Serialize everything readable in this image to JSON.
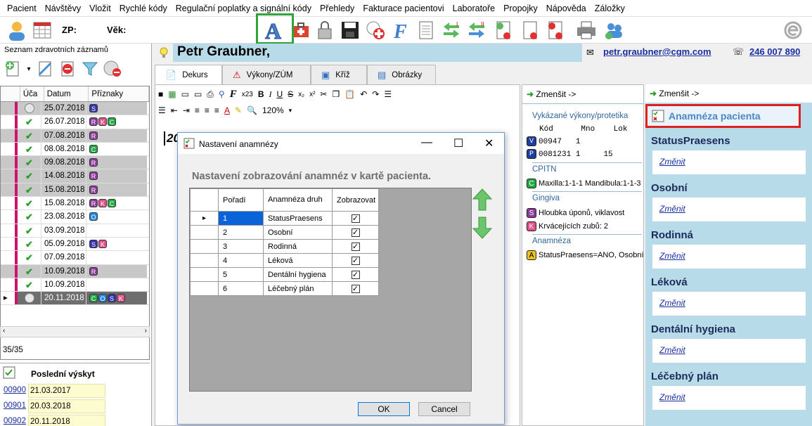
{
  "menu": [
    "Pacient",
    "Návštěvy",
    "Vložit",
    "Rychlé kódy",
    "Regulační poplatky a signální kódy",
    "Přehledy",
    "Fakturace pacientovi",
    "Laboratoře",
    "Propojky",
    "Nápověda",
    "Záložky"
  ],
  "toolbar": {
    "zp_label": "ZP:",
    "vek_label": "Věk:"
  },
  "left": {
    "title": "Seznam zdravotních záznamů",
    "columns": [
      "Úča",
      "Datum",
      "Příznaky"
    ],
    "rows": [
      {
        "date": "25.07.2018",
        "status": "circle",
        "badges": [
          "S"
        ],
        "shade": "dark"
      },
      {
        "date": "26.07.2018",
        "status": "check",
        "badges": [
          "R",
          "K",
          "C"
        ],
        "shade": "light"
      },
      {
        "date": "07.08.2018",
        "status": "check",
        "badges": [
          "R"
        ],
        "shade": "dark"
      },
      {
        "date": "08.08.2018",
        "status": "check",
        "badges": [
          "C"
        ],
        "shade": "light"
      },
      {
        "date": "09.08.2018",
        "status": "check",
        "badges": [
          "R"
        ],
        "shade": "dark"
      },
      {
        "date": "14.08.2018",
        "status": "check",
        "badges": [
          "R"
        ],
        "shade": "dark"
      },
      {
        "date": "15.08.2018",
        "status": "check",
        "badges": [
          "R"
        ],
        "shade": "dark"
      },
      {
        "date": "15.08.2018",
        "status": "check",
        "badges": [
          "R",
          "K",
          "C"
        ],
        "shade": "light"
      },
      {
        "date": "23.08.2018",
        "status": "check",
        "badges": [
          "O"
        ],
        "shade": "light"
      },
      {
        "date": "03.09.2018",
        "status": "check",
        "badges": [],
        "shade": "light"
      },
      {
        "date": "05.09.2018",
        "status": "check",
        "badges": [
          "S",
          "K"
        ],
        "shade": "light"
      },
      {
        "date": "07.09.2018",
        "status": "check",
        "badges": [],
        "shade": "light"
      },
      {
        "date": "10.09.2018",
        "status": "check",
        "badges": [
          "R"
        ],
        "shade": "dark"
      },
      {
        "date": "10.09.2018",
        "status": "check",
        "badges": [],
        "shade": "light"
      },
      {
        "date": "20.11.2018",
        "status": "circle",
        "badges": [
          "C",
          "O",
          "S",
          "K"
        ],
        "shade": "sel"
      }
    ],
    "count": "35/35",
    "bottom_header": "Poslední výskyt",
    "bottom_rows": [
      {
        "code": "00900",
        "date": "21.03.2017"
      },
      {
        "code": "00901",
        "date": "20.03.2018"
      },
      {
        "code": "00902",
        "date": "20.11.2018"
      }
    ]
  },
  "patient": {
    "name": "Petr Graubner,",
    "email": "petr.graubner@cgm.com",
    "phone": "246 007 890"
  },
  "tabs": [
    "Dekurs",
    "Výkony/ZÚM",
    "Kříž",
    "Obrázky"
  ],
  "editor": {
    "zoom": "120%",
    "fontsize": "x23"
  },
  "mid": {
    "zmensit": "Zmenšit ->",
    "sec1": "Vykázané výkony/protetika",
    "cols": [
      "Kód",
      "Mno",
      "Lok"
    ],
    "rows": [
      {
        "tag": "V",
        "code": "00947",
        "mno": "1",
        "lok": ""
      },
      {
        "tag": "P",
        "code": "0081231",
        "mno": "1",
        "lok": "15"
      }
    ],
    "sec2": "CPITN",
    "cpitn": "Maxilla:1-1-1 Mandibula:1-1-3",
    "sec3": "Gingiva",
    "gingiva": [
      "Hloubka úponů, viklavost",
      "Krvácejících zubů: 2"
    ],
    "sec4": "Anamnéza",
    "anamneza": "StatusPraesens=ANO, Osobní="
  },
  "right": {
    "zmensit": "Zmenšit ->",
    "title": "Anamnéza pacienta",
    "sections": [
      {
        "heading": "StatusPraesens",
        "link": "Změnit"
      },
      {
        "heading": "Osobní",
        "link": "Změnit"
      },
      {
        "heading": "Rodinná",
        "link": "Změnit"
      },
      {
        "heading": "Léková",
        "link": "Změnit"
      },
      {
        "heading": "Dentální hygiena",
        "link": "Změnit"
      },
      {
        "heading": "Léčebný plán",
        "link": "Změnit"
      }
    ]
  },
  "dialog": {
    "title": "Nastavení anamnézy",
    "heading": "Nastavení zobrazování anamnéz v kartě pacienta.",
    "col_order": "Pořadí",
    "col_type": "Anamnéza druh",
    "col_show": "Zobrazovat",
    "rows": [
      {
        "order": "1",
        "type": "StatusPraesens",
        "show": true
      },
      {
        "order": "2",
        "type": "Osobní",
        "show": true
      },
      {
        "order": "3",
        "type": "Rodinná",
        "show": true
      },
      {
        "order": "4",
        "type": "Léková",
        "show": true
      },
      {
        "order": "5",
        "type": "Dentální hygiena",
        "show": true
      },
      {
        "order": "6",
        "type": "Léčebný plán",
        "show": true
      }
    ],
    "ok": "OK",
    "cancel": "Cancel"
  },
  "editor_partial": "20",
  "colors": {
    "accent_blue": "#b7dbe8",
    "highlight_red": "#e02020",
    "highlight_green": "#2ea43a"
  }
}
